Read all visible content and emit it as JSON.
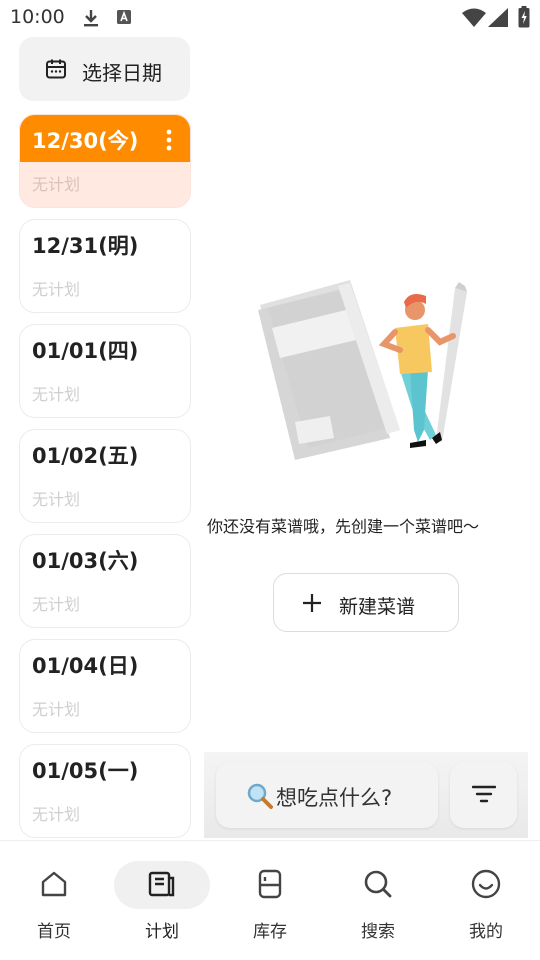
{
  "status_bar": {
    "time": "10:00"
  },
  "date_picker": {
    "label": "选择日期",
    "icon": "calendar-icon"
  },
  "days": [
    {
      "date": "12/30(今)",
      "plan": "无计划",
      "today": true
    },
    {
      "date": "12/31(明)",
      "plan": "无计划"
    },
    {
      "date": "01/01(四)",
      "plan": "无计划"
    },
    {
      "date": "01/02(五)",
      "plan": "无计划"
    },
    {
      "date": "01/03(六)",
      "plan": "无计划"
    },
    {
      "date": "01/04(日)",
      "plan": "无计划"
    },
    {
      "date": "01/05(一)",
      "plan": "无计划"
    }
  ],
  "empty_state": {
    "message": "你还没有菜谱哦，先创建一个菜谱吧～",
    "new_button_label": "新建菜谱"
  },
  "search": {
    "label": "想吃点什么?"
  },
  "nav": [
    {
      "label": "首页",
      "icon": "home-icon"
    },
    {
      "label": "计划",
      "icon": "plan-icon",
      "active": true
    },
    {
      "label": "库存",
      "icon": "inventory-icon"
    },
    {
      "label": "搜索",
      "icon": "search-icon"
    },
    {
      "label": "我的",
      "icon": "profile-icon"
    }
  ],
  "colors": {
    "accent": "#ff8c00",
    "today_bg": "#ffe9e1",
    "muted_text": "#cfcfcf"
  }
}
